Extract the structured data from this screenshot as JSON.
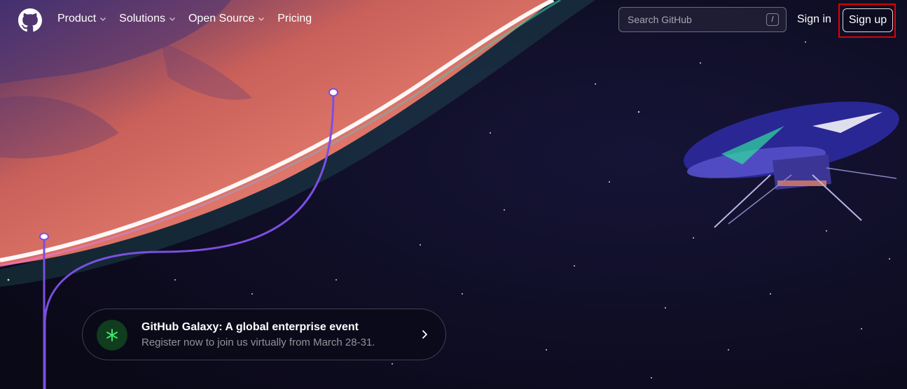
{
  "nav": {
    "items": [
      {
        "label": "Product",
        "has_dropdown": true
      },
      {
        "label": "Solutions",
        "has_dropdown": true
      },
      {
        "label": "Open Source",
        "has_dropdown": true
      },
      {
        "label": "Pricing",
        "has_dropdown": false
      }
    ]
  },
  "search": {
    "placeholder": "Search GitHub",
    "shortcut": "/"
  },
  "auth": {
    "signin_label": "Sign in",
    "signup_label": "Sign up"
  },
  "banner": {
    "title": "GitHub Galaxy: A global enterprise event",
    "subtitle": "Register now to join us virtually from March 28-31."
  },
  "icons": {
    "logo": "github-logo-icon",
    "chevron": "chevron-down-icon",
    "banner": "asterisk-icon",
    "arrow": "chevron-right-icon"
  },
  "colors": {
    "highlight": "#e00000",
    "banner_icon_bg": "#0f3d1d",
    "banner_icon_fg": "#3ee36e",
    "line": "#7b4fe0"
  }
}
